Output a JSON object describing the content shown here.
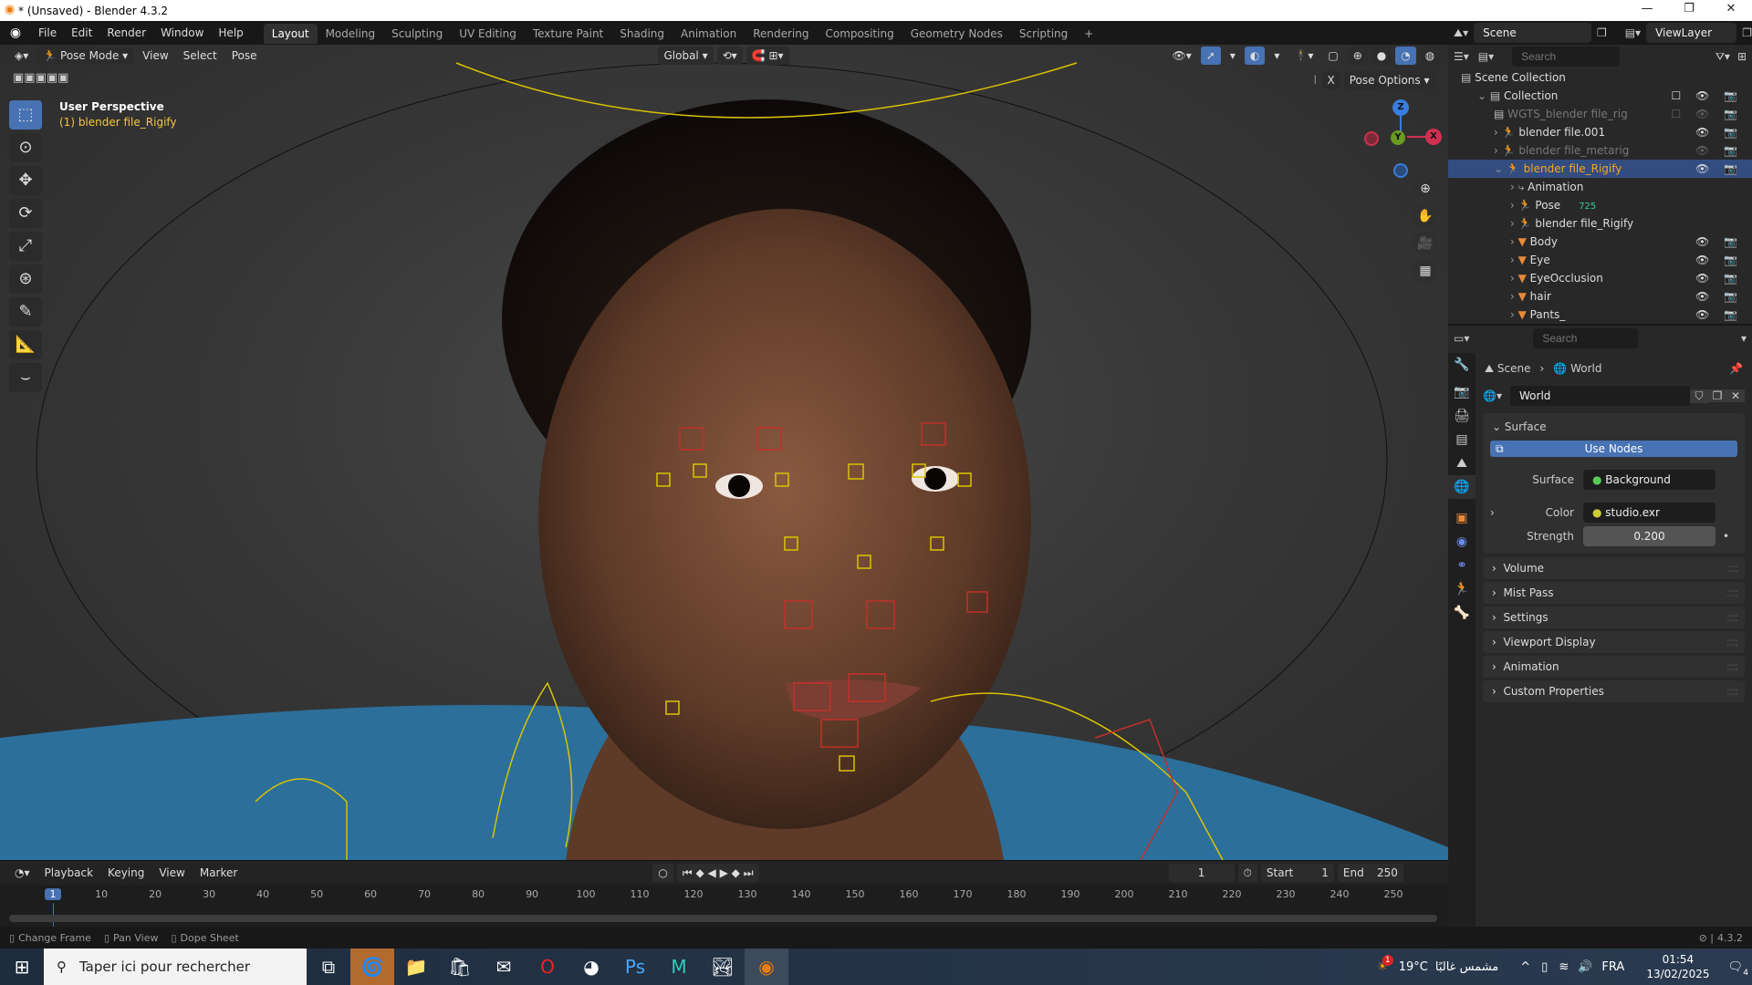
{
  "window": {
    "title": "* (Unsaved) - Blender 4.3.2"
  },
  "menu": [
    "File",
    "Edit",
    "Render",
    "Window",
    "Help"
  ],
  "workspaces": [
    "Layout",
    "Modeling",
    "Sculpting",
    "UV Editing",
    "Texture Paint",
    "Shading",
    "Animation",
    "Rendering",
    "Compositing",
    "Geometry Nodes",
    "Scripting",
    "+"
  ],
  "active_workspace": "Layout",
  "viewport_header": {
    "mode": "Pose Mode",
    "menus": [
      "View",
      "Select",
      "Pose"
    ],
    "orientation": "Global",
    "pose_options": "Pose Options",
    "x_mirror": "X"
  },
  "viewport_overlay": {
    "view_name": "User Perspective",
    "object": "(1) blender file_Rigify"
  },
  "gizmo": {
    "z": "Z",
    "y": "Y",
    "x": "X"
  },
  "scene_selector": {
    "scene": "Scene",
    "view_layer": "ViewLayer"
  },
  "outliner": {
    "search_placeholder": "Search",
    "items": [
      {
        "label": "Scene Collection",
        "depth": 0
      },
      {
        "label": "Collection",
        "depth": 1
      },
      {
        "label": "WGTS_blender file_rig",
        "depth": 2,
        "dim": true
      },
      {
        "label": "blender file.001",
        "depth": 2
      },
      {
        "label": "blender file_metarig",
        "depth": 2,
        "dim": true
      },
      {
        "label": "blender file_Rigify",
        "depth": 2,
        "selected": true
      },
      {
        "label": "Animation",
        "depth": 3
      },
      {
        "label": "Pose",
        "depth": 3,
        "badge": "725"
      },
      {
        "label": "blender file_Rigify",
        "depth": 3
      },
      {
        "label": "Body",
        "depth": 3
      },
      {
        "label": "Eye",
        "depth": 3
      },
      {
        "label": "EyeOcclusion",
        "depth": 3
      },
      {
        "label": "hair",
        "depth": 3
      },
      {
        "label": "Pants_",
        "depth": 3
      }
    ]
  },
  "properties": {
    "search_placeholder": "Search",
    "breadcrumb": [
      "Scene",
      "World"
    ],
    "datablock": "World",
    "surface_panel": "Surface",
    "use_nodes": "Use Nodes",
    "surface_label": "Surface",
    "surface_value": "Background",
    "color_label": "Color",
    "color_value": "studio.exr",
    "strength_label": "Strength",
    "strength_value": "0.200",
    "panels": [
      "Volume",
      "Mist Pass",
      "Settings",
      "Viewport Display",
      "Animation",
      "Custom Properties"
    ]
  },
  "timeline": {
    "menus": [
      "Playback",
      "Keying",
      "View",
      "Marker"
    ],
    "current_frame": "1",
    "start_label": "Start",
    "start": "1",
    "end_label": "End",
    "end": "250",
    "ticks": [
      "1",
      "10",
      "20",
      "30",
      "40",
      "50",
      "60",
      "70",
      "80",
      "90",
      "100",
      "110",
      "120",
      "130",
      "140",
      "150",
      "160",
      "170",
      "180",
      "190",
      "200",
      "210",
      "220",
      "230",
      "240",
      "250"
    ]
  },
  "status": {
    "items": [
      "Change Frame",
      "Pan View",
      "Dope Sheet"
    ],
    "version": "4.3.2"
  },
  "taskbar": {
    "search_placeholder": "Taper ici pour rechercher",
    "weather_temp": "19°C",
    "weather_text": "مشمس غالبًا",
    "weather_badge": "1",
    "lang": "FRA",
    "time": "01:54",
    "date": "13/02/2025",
    "notif_count": "4"
  },
  "colors": {
    "accent": "#4772b3",
    "selection": "#334d80",
    "active_object": "#f5a623",
    "bone_yellow": "#d9c400",
    "bone_red": "#c0302a"
  }
}
